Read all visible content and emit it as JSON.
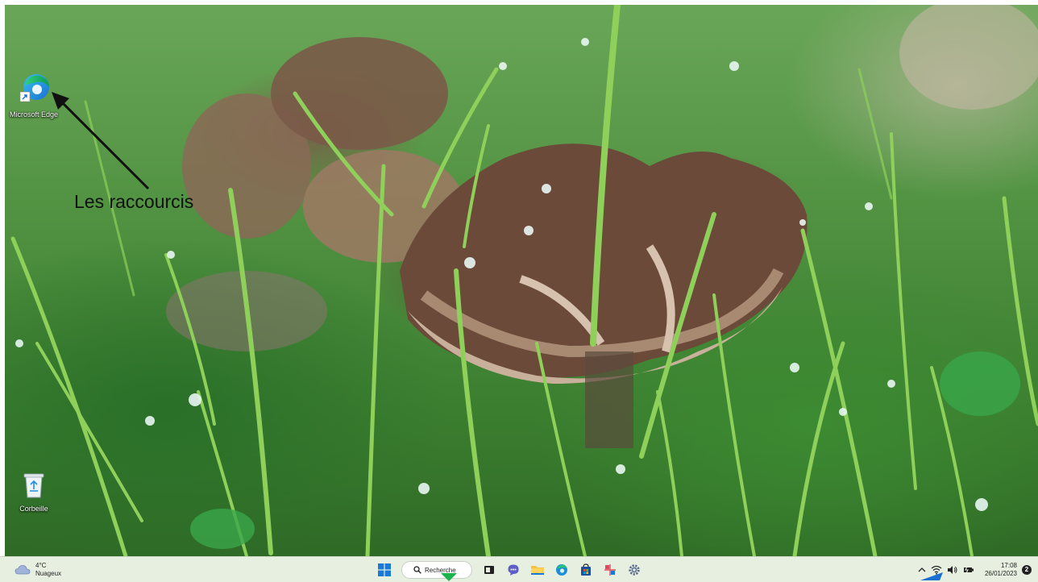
{
  "desktop": {
    "icons": [
      {
        "label": "Microsoft Edge",
        "icon": "edge-icon"
      },
      {
        "label": "Corbeille",
        "icon": "recycle-bin-icon"
      }
    ]
  },
  "annotation": {
    "text": "Les raccourcis",
    "color": "#111111"
  },
  "taskbar": {
    "weather": {
      "temperature": "4°C",
      "condition": "Nuageux",
      "icon": "cloud-icon"
    },
    "search": {
      "label": "Recherche",
      "icon": "search-icon"
    },
    "apps": [
      {
        "name": "start",
        "icon": "windows-start-icon"
      },
      {
        "name": "task-view",
        "icon": "task-view-icon"
      },
      {
        "name": "chat",
        "icon": "chat-icon"
      },
      {
        "name": "file-explorer",
        "icon": "folder-icon"
      },
      {
        "name": "edge",
        "icon": "edge-icon"
      },
      {
        "name": "store",
        "icon": "store-icon"
      },
      {
        "name": "snipping-tool",
        "icon": "snipping-tool-icon"
      },
      {
        "name": "settings",
        "icon": "gear-icon"
      }
    ],
    "tray": {
      "icons": [
        "chevron-up-icon",
        "wifi-icon",
        "speaker-icon",
        "battery-icon"
      ],
      "time": "17:08",
      "date": "26/01/2023",
      "notifications": "2"
    },
    "colors": {
      "background": "#e6efe0",
      "accent_marker": "#1cb34a",
      "tray_marker": "#1a6fd1"
    }
  }
}
